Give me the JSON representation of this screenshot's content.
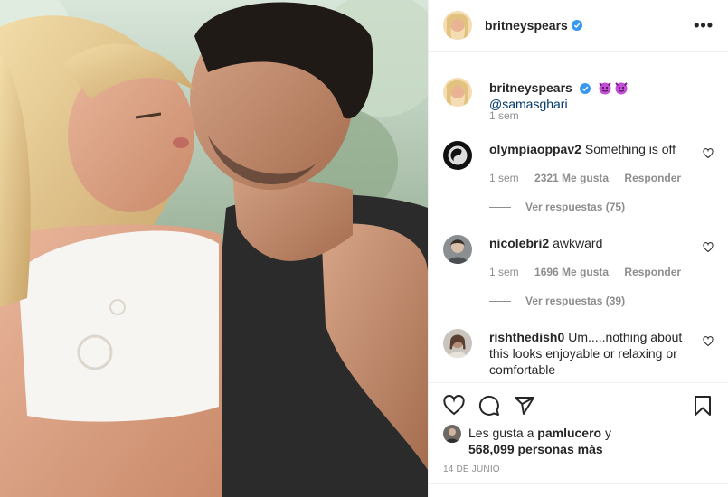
{
  "post": {
    "author": "britneyspears",
    "caption_mention": "@samasghari",
    "caption_time": "1 sem",
    "date": "14 DE JUNIO"
  },
  "comments": [
    {
      "user": "olympiaoppav2",
      "text": "Something is off",
      "time": "1 sem",
      "likes": "2321 Me gusta",
      "reply": "Responder",
      "replies": "Ver respuestas (75)"
    },
    {
      "user": "nicolebri2",
      "text": "awkward",
      "time": "1 sem",
      "likes": "1696 Me gusta",
      "reply": "Responder",
      "replies": "Ver respuestas (39)"
    },
    {
      "user": "rishthedish0",
      "text": "Um.....nothing about this looks enjoyable or relaxing or comfortable"
    }
  ],
  "likes": {
    "prefix": "Les gusta a",
    "user": "pamlucero",
    "conj": "y",
    "count": "568,099 personas más"
  },
  "icons": [
    "more-icon",
    "verified-icon",
    "heart-icon",
    "comment-icon",
    "share-icon",
    "save-icon",
    "devil-emoji"
  ],
  "colors": {
    "verified": "#3897f0",
    "mention": "#00376b",
    "muted": "#8e8e8e"
  }
}
